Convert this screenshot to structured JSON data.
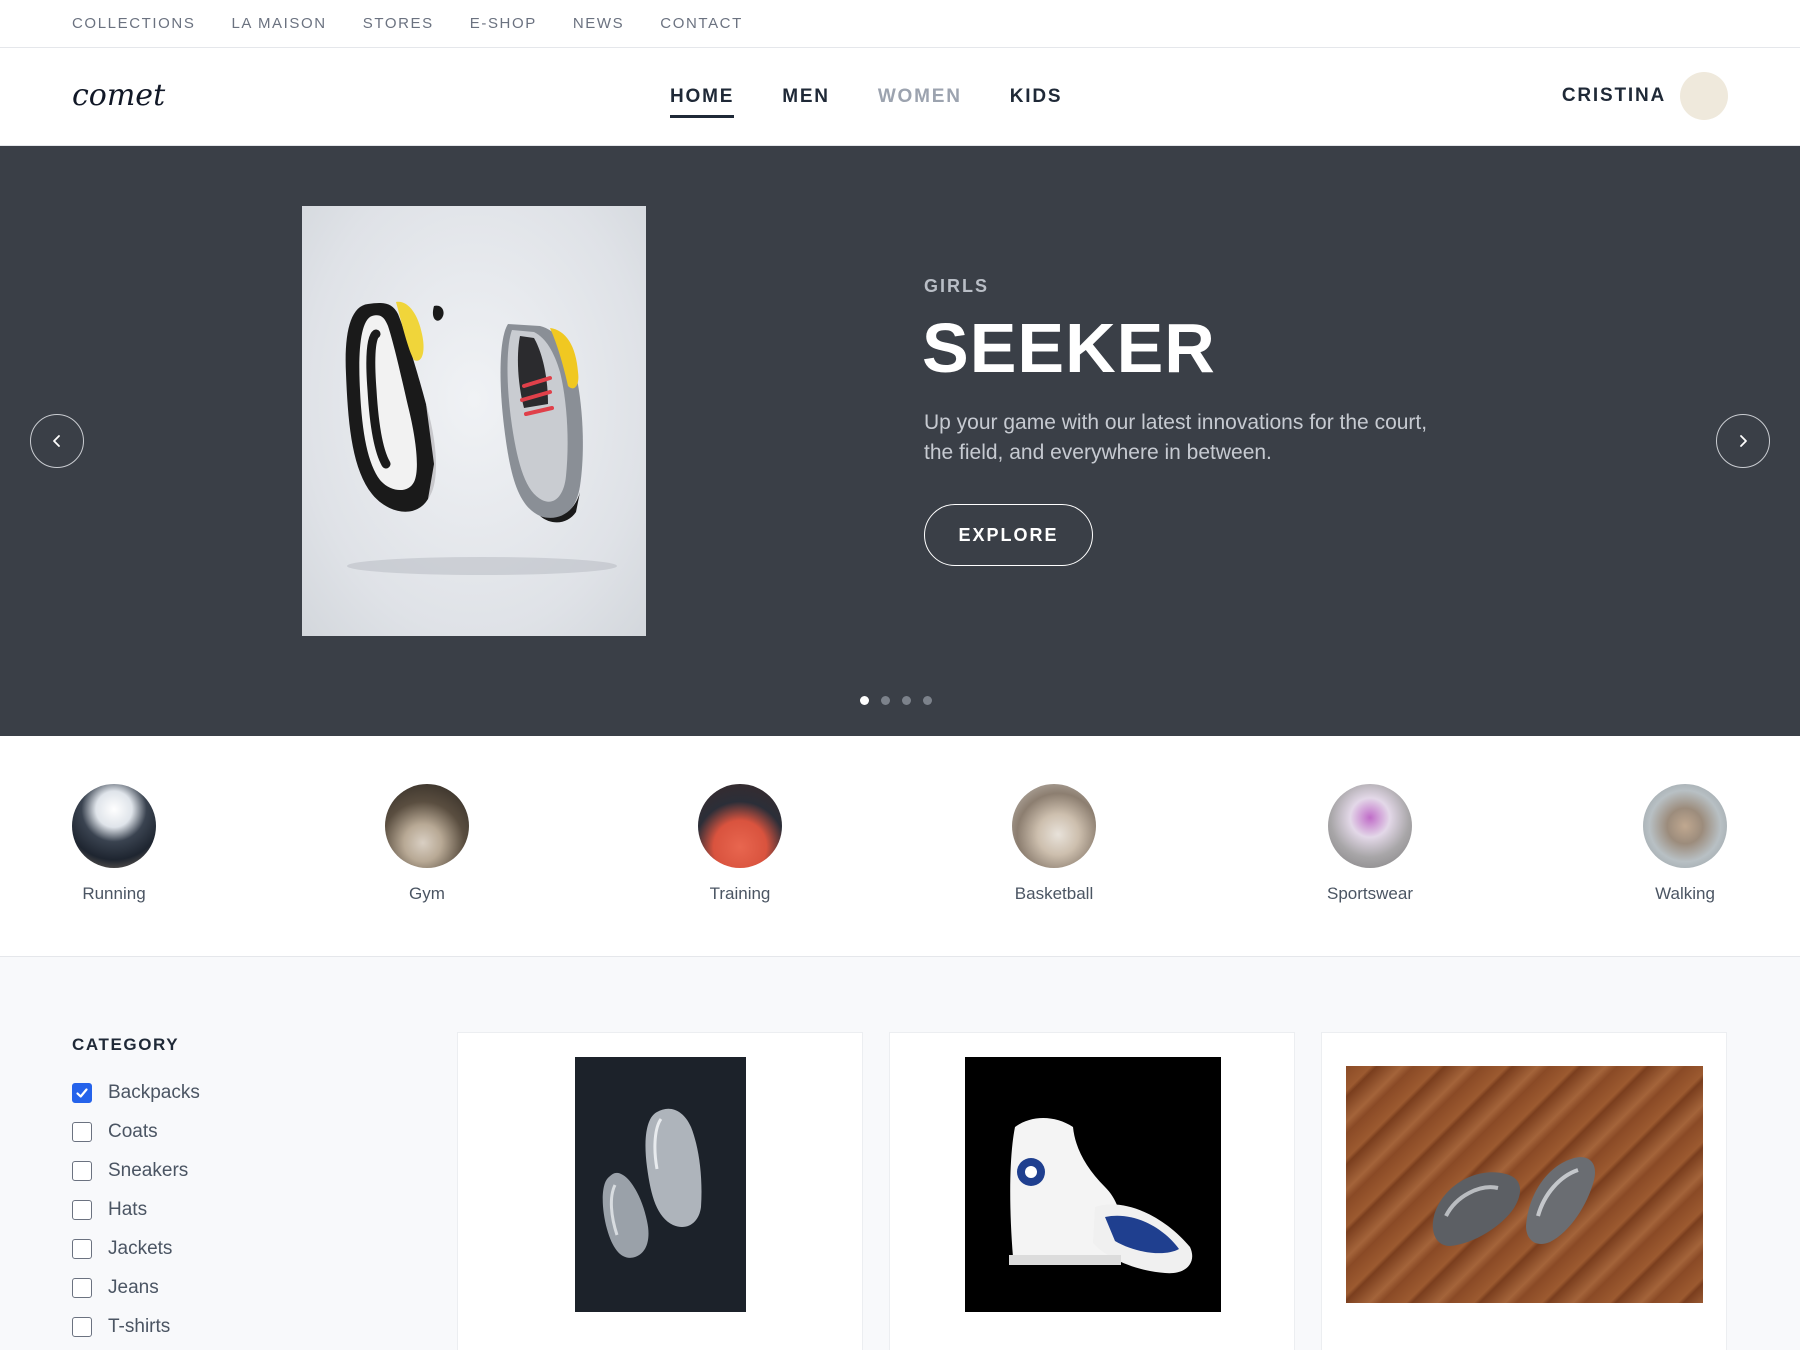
{
  "topbar": {
    "links": [
      "COLLECTIONS",
      "LA MAISON",
      "STORES",
      "E-SHOP",
      "NEWS",
      "CONTACT"
    ]
  },
  "header": {
    "logo": "comet",
    "nav": [
      {
        "label": "HOME",
        "state": "active"
      },
      {
        "label": "MEN",
        "state": "default"
      },
      {
        "label": "WOMEN",
        "state": "muted"
      },
      {
        "label": "KIDS",
        "state": "default"
      }
    ],
    "user_name": "CRISTINA"
  },
  "hero": {
    "kicker": "GIRLS",
    "title": "SEEKER",
    "description": "Up your game with our latest innovations for the court, the field, and everywhere in between.",
    "cta": "EXPLORE",
    "slides_total": 4,
    "active_slide": 1,
    "background": "#3a3f47"
  },
  "activities": [
    "Running",
    "Gym",
    "Training",
    "Basketball",
    "Sportswear",
    "Walking"
  ],
  "filters": {
    "title": "CATEGORY",
    "items": [
      {
        "label": "Backpacks",
        "checked": true
      },
      {
        "label": "Coats",
        "checked": false
      },
      {
        "label": "Sneakers",
        "checked": false
      },
      {
        "label": "Hats",
        "checked": false
      },
      {
        "label": "Jackets",
        "checked": false
      },
      {
        "label": "Jeans",
        "checked": false
      },
      {
        "label": "T-shirts",
        "checked": false
      }
    ]
  },
  "colors": {
    "accent": "#2563eb",
    "text": "#1f2937",
    "muted": "#9ca3af"
  }
}
